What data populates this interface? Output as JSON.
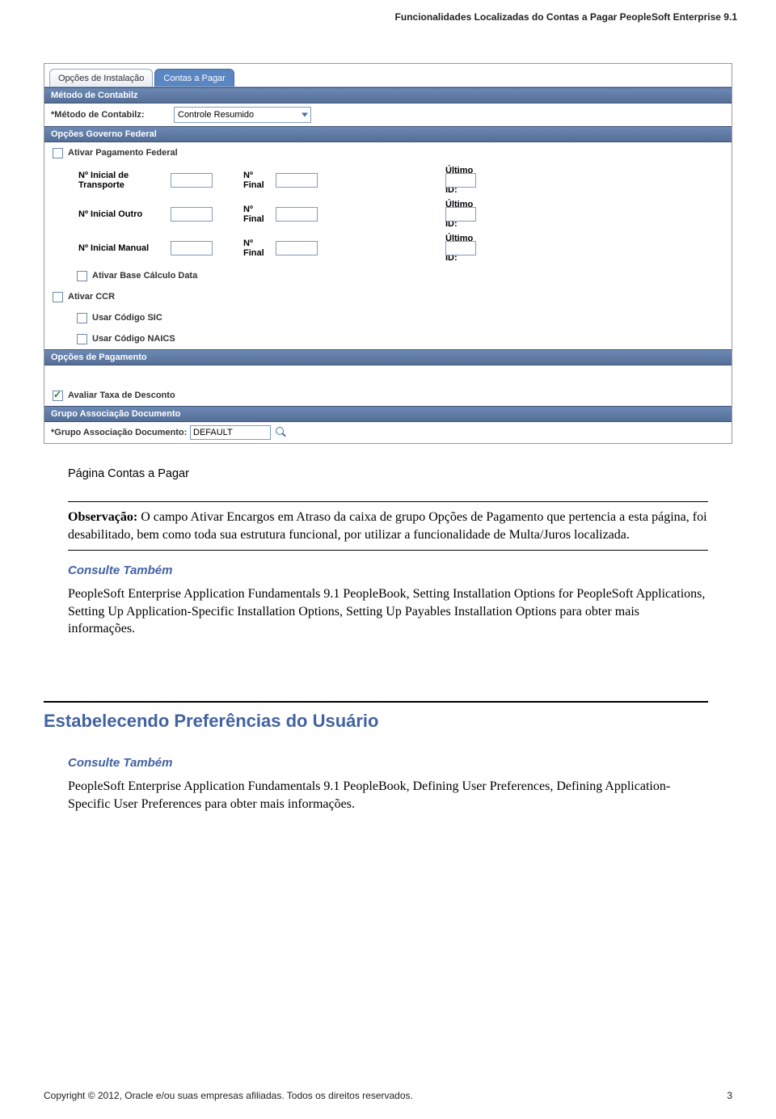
{
  "header": {
    "running_title": "Funcionalidades Localizadas do Contas a Pagar PeopleSoft Enterprise 9.1"
  },
  "screenshot": {
    "tabs": {
      "inactive": "Opções de Instalação",
      "active": "Contas a Pagar"
    },
    "sections": {
      "metodo_contabilz": {
        "title": "Método de Contabilz",
        "label": "*Método de Contabilz:",
        "value": "Controle Resumido"
      },
      "gov_federal": {
        "title": "Opções Governo Federal",
        "ativar_pagamento_federal": "Ativar Pagamento Federal",
        "rows": [
          {
            "l1": "Nº Inicial de Transporte",
            "l2": "Nº Final",
            "l3": "Último Nº ID:"
          },
          {
            "l1": "Nº Inicial Outro",
            "l2": "Nº Final",
            "l3": "Último Nº ID:"
          },
          {
            "l1": "Nº Inicial Manual",
            "l2": "Nº Final",
            "l3": "Último Nº ID:"
          }
        ],
        "ativar_base_calc": "Ativar Base Cálculo Data",
        "ativar_ccr": "Ativar CCR",
        "usar_sic": "Usar Código SIC",
        "usar_naics": "Usar Código NAICS"
      },
      "pagamento": {
        "title": "Opções de Pagamento",
        "avaliar_taxa": "Avaliar Taxa de Desconto"
      },
      "grupo_assoc": {
        "title": "Grupo Associação Documento",
        "label": "*Grupo Associação Documento:",
        "value": "DEFAULT"
      }
    }
  },
  "body": {
    "caption": "Página Contas a Pagar",
    "observacao_label": "Observação:",
    "observacao_text": " O campo Ativar Encargos em Atraso da caixa de grupo Opções de Pagamento que pertencia a esta página, foi desabilitado, bem como toda sua estrutura funcional, por utilizar a funcionalidade de Multa/Juros localizada.",
    "see_also": "Consulte Também",
    "ref1": "PeopleSoft Enterprise Application Fundamentals 9.1 PeopleBook, Setting Installation Options for PeopleSoft Applications, Setting Up Application-Specific Installation Options, Setting Up Payables Installation Options para obter mais informações.",
    "h2": "Estabelecendo Preferências do Usuário",
    "see_also2": "Consulte Também",
    "ref2": "PeopleSoft Enterprise Application Fundamentals 9.1 PeopleBook, Defining User Preferences, Defining Application-Specific User Preferences para obter mais informações."
  },
  "footer": {
    "copyright": "Copyright © 2012, Oracle e/ou suas empresas afiliadas. Todos os direitos reservados.",
    "page_no": "3"
  }
}
